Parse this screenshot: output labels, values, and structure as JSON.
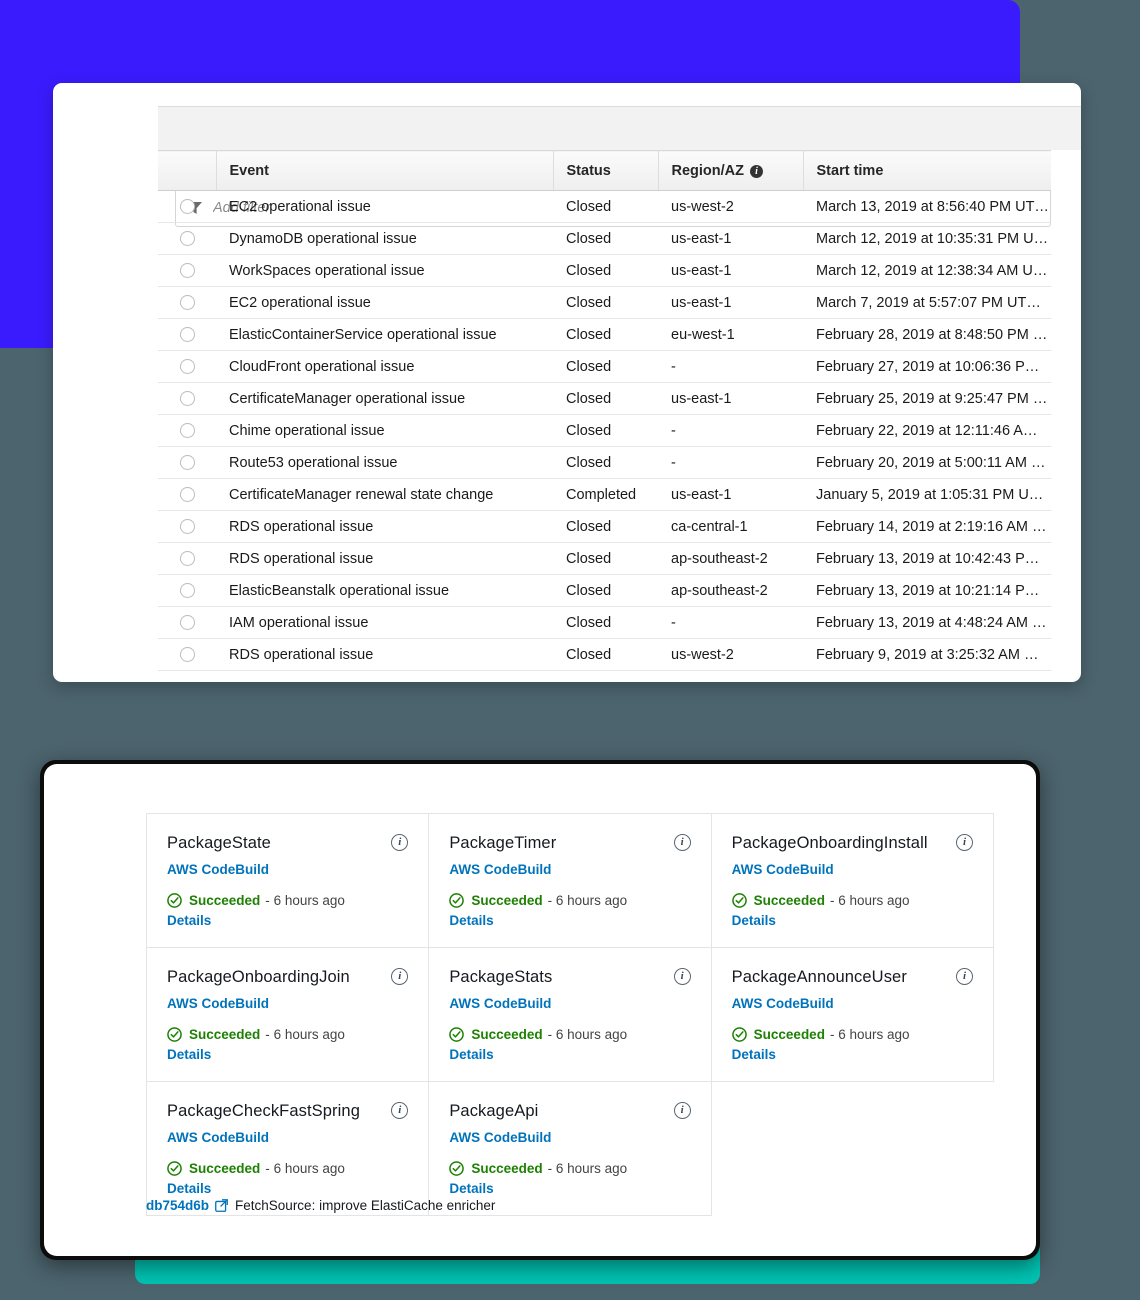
{
  "decor": {
    "blue_color": "#3a1bfd",
    "teal_color": "#00c4b3",
    "page_background": "#4c646e"
  },
  "health_panel": {
    "filter": {
      "placeholder": "Add filter",
      "value": "",
      "icon": "funnel-icon"
    },
    "columns": [
      {
        "key": "select",
        "label": ""
      },
      {
        "key": "event",
        "label": "Event"
      },
      {
        "key": "status",
        "label": "Status"
      },
      {
        "key": "region",
        "label": "Region/AZ",
        "info_icon": "info-circle-icon"
      },
      {
        "key": "start_time",
        "label": "Start time"
      }
    ],
    "rows": [
      {
        "event": "EC2 operational issue",
        "status": "Closed",
        "region": "us-west-2",
        "start_time": "March 13, 2019 at 8:56:40 PM UT…"
      },
      {
        "event": "DynamoDB operational issue",
        "status": "Closed",
        "region": "us-east-1",
        "start_time": "March 12, 2019 at 10:35:31 PM U…"
      },
      {
        "event": "WorkSpaces operational issue",
        "status": "Closed",
        "region": "us-east-1",
        "start_time": "March 12, 2019 at 12:38:34 AM U…"
      },
      {
        "event": "EC2 operational issue",
        "status": "Closed",
        "region": "us-east-1",
        "start_time": "March 7, 2019 at 5:57:07 PM UT…"
      },
      {
        "event": "ElasticContainerService operational issue",
        "status": "Closed",
        "region": "eu-west-1",
        "start_time": "February 28, 2019 at 8:48:50 PM …"
      },
      {
        "event": "CloudFront operational issue",
        "status": "Closed",
        "region": "-",
        "start_time": "February 27, 2019 at 10:06:36 P…"
      },
      {
        "event": "CertificateManager operational issue",
        "status": "Closed",
        "region": "us-east-1",
        "start_time": "February 25, 2019 at 9:25:47 PM …"
      },
      {
        "event": "Chime operational issue",
        "status": "Closed",
        "region": "-",
        "start_time": "February 22, 2019 at 12:11:46 A…"
      },
      {
        "event": "Route53 operational issue",
        "status": "Closed",
        "region": "-",
        "start_time": "February 20, 2019 at 5:00:11 AM …"
      },
      {
        "event": "CertificateManager renewal state change",
        "status": "Completed",
        "region": "us-east-1",
        "start_time": "January 5, 2019 at 1:05:31 PM U…"
      },
      {
        "event": "RDS operational issue",
        "status": "Closed",
        "region": "ca-central-1",
        "start_time": "February 14, 2019 at 2:19:16 AM …"
      },
      {
        "event": "RDS operational issue",
        "status": "Closed",
        "region": "ap-southeast-2",
        "start_time": "February 13, 2019 at 10:42:43 P…"
      },
      {
        "event": "ElasticBeanstalk operational issue",
        "status": "Closed",
        "region": "ap-southeast-2",
        "start_time": "February 13, 2019 at 10:21:14 P…"
      },
      {
        "event": "IAM operational issue",
        "status": "Closed",
        "region": "-",
        "start_time": "February 13, 2019 at 4:48:24 AM …"
      },
      {
        "event": "RDS operational issue",
        "status": "Closed",
        "region": "us-west-2",
        "start_time": "February 9, 2019 at 3:25:32 AM …"
      }
    ],
    "status_color": "#0ea54a"
  },
  "pipeline_panel": {
    "cards": [
      {
        "title": "PackageState",
        "provider": "AWS CodeBuild",
        "status": "Succeeded",
        "separator": "-",
        "time": "6 hours ago",
        "details": "Details",
        "info_icon": "info-circle-icon",
        "status_icon": "check-circle-icon"
      },
      {
        "title": "PackageTimer",
        "provider": "AWS CodeBuild",
        "status": "Succeeded",
        "separator": "-",
        "time": "6 hours ago",
        "details": "Details",
        "info_icon": "info-circle-icon",
        "status_icon": "check-circle-icon"
      },
      {
        "title": "PackageOnboardingInstall",
        "provider": "AWS CodeBuild",
        "status": "Succeeded",
        "separator": "-",
        "time": "6 hours ago",
        "details": "Details",
        "info_icon": "info-circle-icon",
        "status_icon": "check-circle-icon"
      },
      {
        "title": "PackageOnboardingJoin",
        "provider": "AWS CodeBuild",
        "status": "Succeeded",
        "separator": "-",
        "time": "6 hours ago",
        "details": "Details",
        "info_icon": "info-circle-icon",
        "status_icon": "check-circle-icon"
      },
      {
        "title": "PackageStats",
        "provider": "AWS CodeBuild",
        "status": "Succeeded",
        "separator": "-",
        "time": "6 hours ago",
        "details": "Details",
        "info_icon": "info-circle-icon",
        "status_icon": "check-circle-icon"
      },
      {
        "title": "PackageAnnounceUser",
        "provider": "AWS CodeBuild",
        "status": "Succeeded",
        "separator": "-",
        "time": "6 hours ago",
        "details": "Details",
        "info_icon": "info-circle-icon",
        "status_icon": "check-circle-icon"
      },
      {
        "title": "PackageCheckFastSpring",
        "provider": "AWS CodeBuild",
        "status": "Succeeded",
        "separator": "-",
        "time": "6 hours ago",
        "details": "Details",
        "info_icon": "info-circle-icon",
        "status_icon": "check-circle-icon"
      },
      {
        "title": "PackageApi",
        "provider": "AWS CodeBuild",
        "status": "Succeeded",
        "separator": "-",
        "time": "6 hours ago",
        "details": "Details",
        "info_icon": "info-circle-icon",
        "status_icon": "check-circle-icon"
      }
    ],
    "commit": {
      "hash": "db754d6b",
      "message": "FetchSource: improve ElastiCache enricher",
      "link_icon": "external-link-icon"
    },
    "link_color": "#0073bb",
    "success_color": "#1d8102"
  }
}
